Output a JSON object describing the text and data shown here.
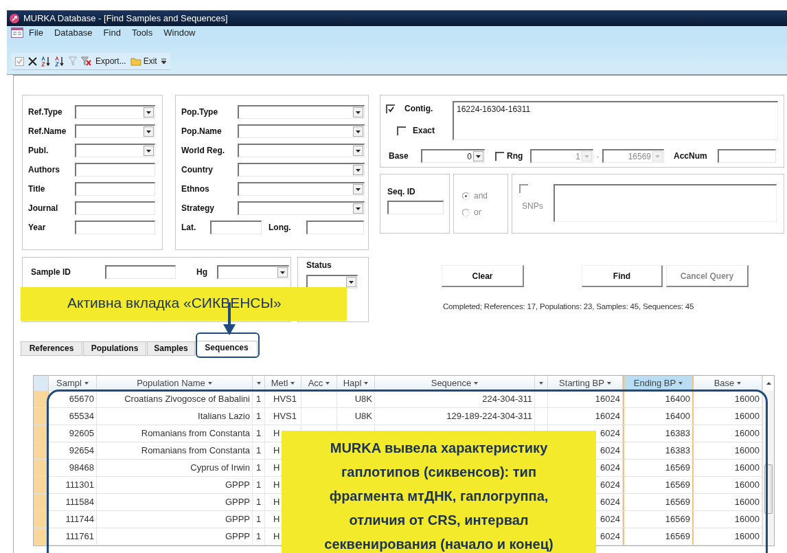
{
  "window": {
    "title": "MURKA Database - [Find Samples and Sequences]"
  },
  "menu": [
    "File",
    "Database",
    "Find",
    "Tools",
    "Window"
  ],
  "toolbar": [
    {
      "kind": "select",
      "disabled": true
    },
    {
      "kind": "delete",
      "disabled": false
    },
    {
      "kind": "sort-asc",
      "disabled": false
    },
    {
      "kind": "sort-desc",
      "disabled": false
    },
    {
      "kind": "filter",
      "disabled": true
    },
    {
      "kind": "clear-filter",
      "disabled": false
    },
    {
      "kind": "export",
      "label": "Export...",
      "disabled": false
    },
    {
      "kind": "exit",
      "label": "Exit",
      "disabled": false
    }
  ],
  "reference_filters": [
    {
      "label": "Ref.Type",
      "kind": "combo"
    },
    {
      "label": "Ref.Name",
      "kind": "combo"
    },
    {
      "label": "Publ.",
      "kind": "combo"
    },
    {
      "label": "Authors",
      "kind": "text"
    },
    {
      "label": "Title",
      "kind": "text"
    },
    {
      "label": "Journal",
      "kind": "text"
    },
    {
      "label": "Year",
      "kind": "text"
    }
  ],
  "population_filters": [
    {
      "label": "Pop.Type",
      "kind": "combo"
    },
    {
      "label": "Pop.Name",
      "kind": "combo"
    },
    {
      "label": "World Reg.",
      "kind": "combo"
    },
    {
      "label": "Country",
      "kind": "combo"
    },
    {
      "label": "Ethnos",
      "kind": "combo"
    },
    {
      "label": "Strategy",
      "kind": "combo"
    }
  ],
  "coordinates": [
    {
      "label": "Lat."
    },
    {
      "label": "Long."
    }
  ],
  "contig": {
    "label": "Contig.",
    "checked": true,
    "value": "16224-16304-16311",
    "exact": {
      "label": "Exact",
      "checked": false
    }
  },
  "base": {
    "label": "Base",
    "value": "0"
  },
  "range": {
    "label": "Rng",
    "checked": false,
    "disabled": true,
    "from": "1",
    "separator": "-",
    "to": "16569"
  },
  "acc_num": {
    "label": "AccNum"
  },
  "seq_id": {
    "label": "Seq. ID"
  },
  "logic": {
    "disabled": true,
    "options": [
      {
        "label": "and",
        "selected": true
      },
      {
        "label": "or",
        "selected": false
      }
    ]
  },
  "snps": {
    "label": "SNPs",
    "checked": false,
    "disabled": true
  },
  "sample": {
    "sample_id": "Sample ID",
    "hg": "Hg",
    "status": "Status"
  },
  "buttons": [
    {
      "label": "Clear",
      "disabled": false
    },
    {
      "label": "Find",
      "disabled": false
    },
    {
      "label": "Cancel Query",
      "disabled": true
    }
  ],
  "status_text": "Completed; References: 17, Populations: 23, Samples: 45, Sequences: 45",
  "tabs": [
    {
      "label": "References",
      "selected": false
    },
    {
      "label": "Populations",
      "selected": false
    },
    {
      "label": "Samples",
      "selected": false
    },
    {
      "label": "Sequences",
      "selected": true
    }
  ],
  "table": {
    "columns": [
      {
        "label": "Sampl",
        "selected": false
      },
      {
        "label": "Population Name",
        "selected": false
      },
      {
        "selected": false
      },
      {
        "label": "Metl",
        "selected": false
      },
      {
        "label": "Acc",
        "selected": false
      },
      {
        "label": "Hapl",
        "selected": false
      },
      {
        "label": "Sequence",
        "selected": false
      },
      {
        "selected": false
      },
      {
        "label": "Starting BP",
        "selected": false
      },
      {
        "label": "Ending BP",
        "selected": true
      },
      {
        "label": "Base",
        "selected": false
      }
    ],
    "rows": [
      {
        "sample": "65670",
        "population": "Croatians Zivogosce of Babalini",
        "column_3": "1",
        "metl": "HVS1",
        "hapl": "U8K",
        "sequence": "224-304-311",
        "starting_bp": "16024",
        "ending_bp": "16400",
        "base": "16000"
      },
      {
        "sample": "65534",
        "population": "Italians Lazio",
        "column_3": "1",
        "metl": "HVS1",
        "hapl": "U8K",
        "sequence": "129-189-224-304-311",
        "starting_bp": "16024",
        "ending_bp": "16400",
        "base": "16000"
      },
      {
        "sample": "92605",
        "population": "Romanians from Constanta",
        "column_3": "1",
        "metl": "H",
        "starting_bp": "6024",
        "ending_bp": "16383",
        "base": "16000"
      },
      {
        "sample": "92654",
        "population": "Romanians from Constanta",
        "column_3": "1",
        "metl": "H",
        "starting_bp": "6024",
        "ending_bp": "16383",
        "base": "16000"
      },
      {
        "sample": "98468",
        "population": "Cyprus of Irwin",
        "column_3": "1",
        "metl": "H",
        "starting_bp": "6024",
        "ending_bp": "16569",
        "base": "16000"
      },
      {
        "sample": "111301",
        "population": "GPPP",
        "column_3": "1",
        "metl": "H",
        "starting_bp": "6024",
        "ending_bp": "16569",
        "base": "16000"
      },
      {
        "sample": "111584",
        "population": "GPPP",
        "column_3": "1",
        "metl": "H",
        "starting_bp": "6024",
        "ending_bp": "16569",
        "base": "16000"
      },
      {
        "sample": "111744",
        "population": "GPPP",
        "column_3": "1",
        "metl": "H",
        "starting_bp": "6024",
        "ending_bp": "16569",
        "base": "16000"
      },
      {
        "sample": "111761",
        "population": "GPPP",
        "column_3": "1",
        "metl": "H",
        "starting_bp": "6024",
        "ending_bp": "16569",
        "base": "16000"
      }
    ]
  },
  "callouts": [
    {
      "kind": "tab-note",
      "text": "Активна вкладка «СИКВЕНСЫ»"
    },
    {
      "kind": "table-note",
      "text": "MURKA  вывела характеристику\nгаплотипов (сиквенсов): тип\nфрагмента мтДНК, гаплогруппа,\nотличия от CRS,  интервал\nсеквенирования (начало и конец)"
    }
  ]
}
